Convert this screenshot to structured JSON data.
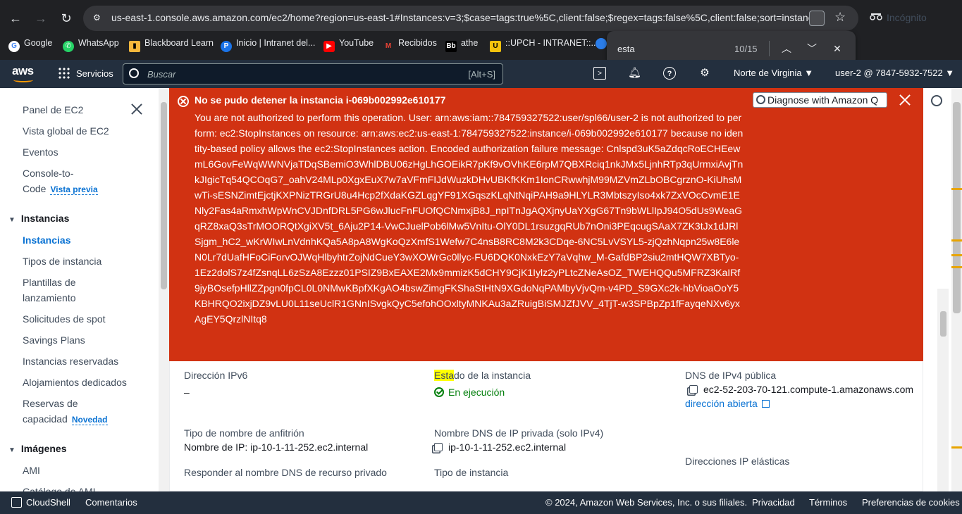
{
  "browser": {
    "url": "us-east-1.console.aws.amazon.com/ec2/home?region=us-east-1#Instances:v=3;$case=tags:true%5C,client:false;$regex=tags:false%5C,client:false;sort=instanc...",
    "incognito_label": "Incógnito",
    "bookmarks": [
      {
        "label": "Google",
        "icon": "google-icon",
        "color": "#4285f4"
      },
      {
        "label": "WhatsApp",
        "icon": "whatsapp-icon",
        "color": "#25d366"
      },
      {
        "label": "Blackboard Learn",
        "icon": "blackboard-icon",
        "color": "#f6b73c"
      },
      {
        "label": "Inicio | Intranet del...",
        "icon": "intranet-icon",
        "color": "#1a73e8"
      },
      {
        "label": "YouTube",
        "icon": "youtube-icon",
        "color": "#ff0000"
      },
      {
        "label": "Recibidos",
        "icon": "gmail-icon",
        "color": "#ea4335"
      },
      {
        "label": "athe",
        "icon": "bb-icon",
        "color": "#000000"
      },
      {
        "label": "::UPCH - INTRANET::...",
        "icon": "upch-icon",
        "color": "#f4c20d"
      }
    ],
    "find": {
      "query": "esta",
      "count": "10/15"
    }
  },
  "aws": {
    "services_label": "Servicios",
    "search_placeholder": "Buscar",
    "search_shortcut": "[Alt+S]",
    "region": "Norte de Virginia ▼",
    "user": "user-2 @ 7847-5932-7522 ▼"
  },
  "sidebar": {
    "items": [
      {
        "label": "Panel de EC2"
      },
      {
        "label": "Vista global de EC2"
      },
      {
        "label": "Eventos"
      },
      {
        "label": "Console-to-"
      },
      {
        "label": "Code"
      },
      {
        "label": "Vista previa"
      }
    ],
    "section_instances": "Instancias",
    "instances_items": [
      "Instancias",
      "Tipos de instancia",
      "Plantillas de",
      "lanzamiento",
      "Solicitudes de spot",
      "Savings Plans",
      "Instancias reservadas",
      "Alojamientos dedicados",
      "Reservas de",
      "capacidad"
    ],
    "novedad": "Novedad",
    "section_images": "Imágenes",
    "images_items": [
      "AMI",
      "Catálogo de AMI"
    ]
  },
  "error": {
    "title": "No se pudo detener la instancia i-069b002992e610177",
    "message": "You are not authorized to perform this operation. User: arn:aws:iam::784759327522:user/spl66/user-2 is not authorized to perform: ec2:StopInstances on resource: arn:aws:ec2:us-east-1:784759327522:instance/i-069b002992e610177 because no identity-based policy allows the ec2:StopInstances action. Encoded authorization failure message: Cnlspd3uK5aZdqcRoECHEewmL6GovFeWqWWNVjaTDqSBemiO3WhlDBU06zHgLhGOEikR7pKf9vOVhKE6rpM7QBXRciq1nkJMx5LjnhRTp3qUrmxiAvjTnkJIgicTq54QCOqG7_oahV24MLp0XgxEuX7w7aVFmFIJdWuzkDHvUBKfKKm1IonCRwwhjM99MZVmZLbOBCgrznO-KiUhsMwTi-sESNZimtEjctjKXPNizTRGrU8u4Hcp2fXdaKGZLqgYF91XGqszKLqNtNqiPAH9a9HLYLR3MbtszyIso4xk7ZxVOcCvmE1ENly2Fas4aRmxhWpWnCVJDnfDRL5PG6wJlucFnFUOfQCNmxjB8J_npITnJgAQXjnyUaYXgG67Tn9bWLlIpJ94O5dUs9WeaGqRZ8xaQ3sTrMOORQtXgiXV5t_6Aju2P14-VwCJuelPob6lMw5VnItu-OlY0DL1rsuzgqRUb7nOni3PEqcugSAaX7ZK3tJx1dJRlSjgm_hC2_wKrWIwLnVdnhKQa5A8pA8WgKoQzXmfS1Wefw7C4nsB8RC8M2k3CDqe-6NC5LvVSYL5-zjQzhNqpn25w8E6leN0Lr7dUafHFoCiForvOJWqHlbyhtrZojNdCueY3wXOWrGc0llyc-FU6DQK0NxkEzY7aVqhw_M-GafdBP2siu2mtHQW7XBTyo-1Ez2dolS7z4fZsnqLL6zSzA8Ezzz01PSIZ9BxEAXE2Mx9mmizK5dCHY9CjK1Iylz2yPLtcZNeAsOZ_TWEHQQu5MFRZ3KaIRf9jyBOsefpHllZZpgn0fpCL0L0NMwKBpfXKgAO4bswZimgFKShaStHtN9XGdoNqPAMbyVjvQm-v4PD_S9GXc2k-hbVioaOoY5KBHRQO2ixjDZ9vLU0L11seUclR1GNnISvgkQyC5efohOOxltyMNKAu3aZRuigBiSMJZfJVV_4TjT-w3SPBpZp1fFayqeNXv6yxAgEY5QrzlNItq8",
    "diagnose_label": "Diagnose with Amazon Q",
    "color": "#d13212"
  },
  "details": {
    "ipv6_label": "Dirección IPv6",
    "ipv6_value": "–",
    "state_label_hl": "Esta",
    "state_label_rest": "do de la instancia",
    "state_value": "En ejecución",
    "dns_public_label": "DNS de IPv4 pública",
    "dns_public_value": "ec2-52-203-70-121.compute-1.amazonaws.com",
    "open_address": "dirección abierta",
    "hostname_label": "Tipo de nombre de anfitrión",
    "hostname_value": "Nombre de IP: ip-10-1-11-252.ec2.internal",
    "private_dns_label": "Nombre DNS de IP privada (solo IPv4)",
    "private_dns_value": "ip-10-1-11-252.ec2.internal",
    "respond_label": "Responder al nombre DNS de recurso privado",
    "instance_type_label": "Tipo de instancia",
    "elastic_ip_label": "Direcciones IP elásticas"
  },
  "footer": {
    "cloudshell": "CloudShell",
    "comments": "Comentarios",
    "copyright": "© 2024, Amazon Web Services, Inc. o sus filiales.",
    "privacy": "Privacidad",
    "terms": "Términos",
    "cookies": "Preferencias de cookies"
  }
}
